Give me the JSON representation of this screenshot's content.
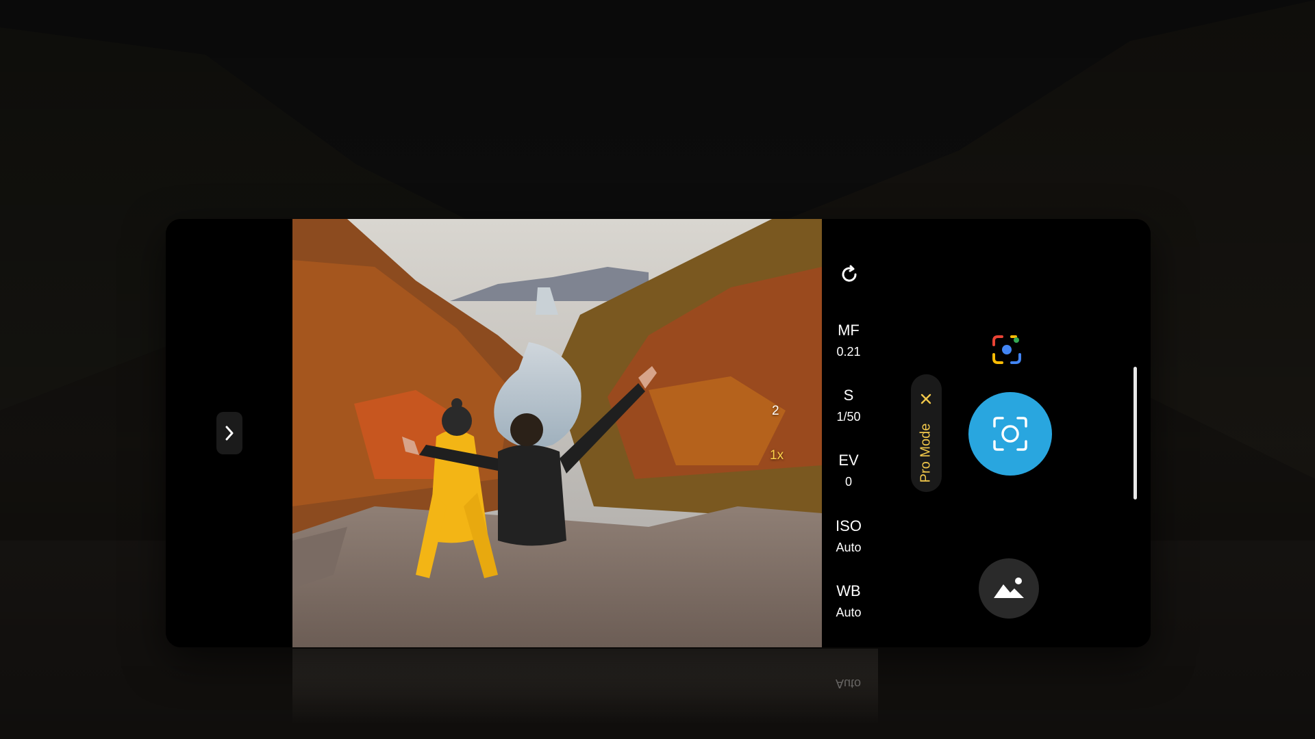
{
  "pro_settings": [
    {
      "name": "MF",
      "value": "0.21"
    },
    {
      "name": "S",
      "value": "1/50"
    },
    {
      "name": "EV",
      "value": "0"
    },
    {
      "name": "ISO",
      "value": "Auto"
    },
    {
      "name": "WB",
      "value": "Auto"
    }
  ],
  "zoom": {
    "level_2": "2",
    "level_1x": "1x"
  },
  "mode": {
    "label": "Pro Mode"
  },
  "reflection_text": "Auto",
  "colors": {
    "shutter": "#29a6df",
    "pro_mode_text": "#f2c84b",
    "zoom_active": "#ffd24a",
    "lens_colors": [
      "#4285f4",
      "#ea4335",
      "#fbbc05",
      "#34a853"
    ]
  },
  "icons": {
    "expand": "chevron-right-icon",
    "refresh": "refresh-icon",
    "close": "close-icon",
    "lens": "google-lens-icon",
    "shutter": "capture-frame-icon",
    "gallery": "gallery-icon"
  }
}
